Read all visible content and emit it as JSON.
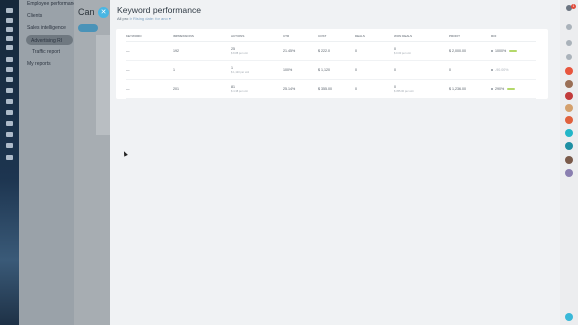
{
  "background_page": {
    "title": "Can",
    "nav_items": [
      "Employee performance",
      "Clients",
      "Sales intelligence",
      "Advertising RI",
      "Traffic report",
      "My reports"
    ]
  },
  "panel": {
    "close_label": "✕",
    "title": "Keyword performance",
    "subtitle_prefix": "All pro",
    "subtitle_link": "Ir Rising date: for ano ▾",
    "columns": [
      "Keyword",
      "Impressions",
      "Actions",
      "CTR",
      "Cost",
      "Deals",
      "Won deals",
      "Profit",
      "ROI"
    ],
    "rows": [
      {
        "keyword": "—",
        "impressions": "192",
        "actions": "25",
        "actions_sub": "$ 8.88 per unit",
        "ctr": "21.45%",
        "cost": "$ 222.0",
        "deals": "0",
        "won_deals": "0",
        "won_sub": "$ 0.00 per unit",
        "profit": "$ 2,000.00",
        "roi": "1000%"
      },
      {
        "keyword": "—",
        "impressions": "1",
        "actions": "1",
        "actions_sub": "$ 1,120 per unit",
        "ctr": "100%",
        "cost": "$ 1,120",
        "deals": "0",
        "won_deals": "0",
        "won_sub": "",
        "profit": "0",
        "roi": "-90.00%"
      },
      {
        "keyword": "—",
        "impressions": "201",
        "actions": "81",
        "actions_sub": "$ 4.38 per unit",
        "ctr": "25.14%",
        "cost": "$ 355.00",
        "deals": "0",
        "won_deals": "0",
        "won_sub": "$ 355.00 per unit",
        "profit": "$ 1,236.00",
        "roi": "290%"
      }
    ]
  },
  "right_rail": {
    "notification_count": "1",
    "icons": [
      "bell-icon",
      "help-icon",
      "settings-icon",
      "search-icon",
      "chat-icon",
      "avatar",
      "avatar",
      "avatar",
      "avatar",
      "avatar",
      "avatar",
      "avatar",
      "avatar",
      "avatar",
      "avatar"
    ]
  },
  "colors": {
    "accent": "#49b6e3",
    "panel_bg": "#f0f2f4",
    "roi_bar": "#b4d86a"
  }
}
